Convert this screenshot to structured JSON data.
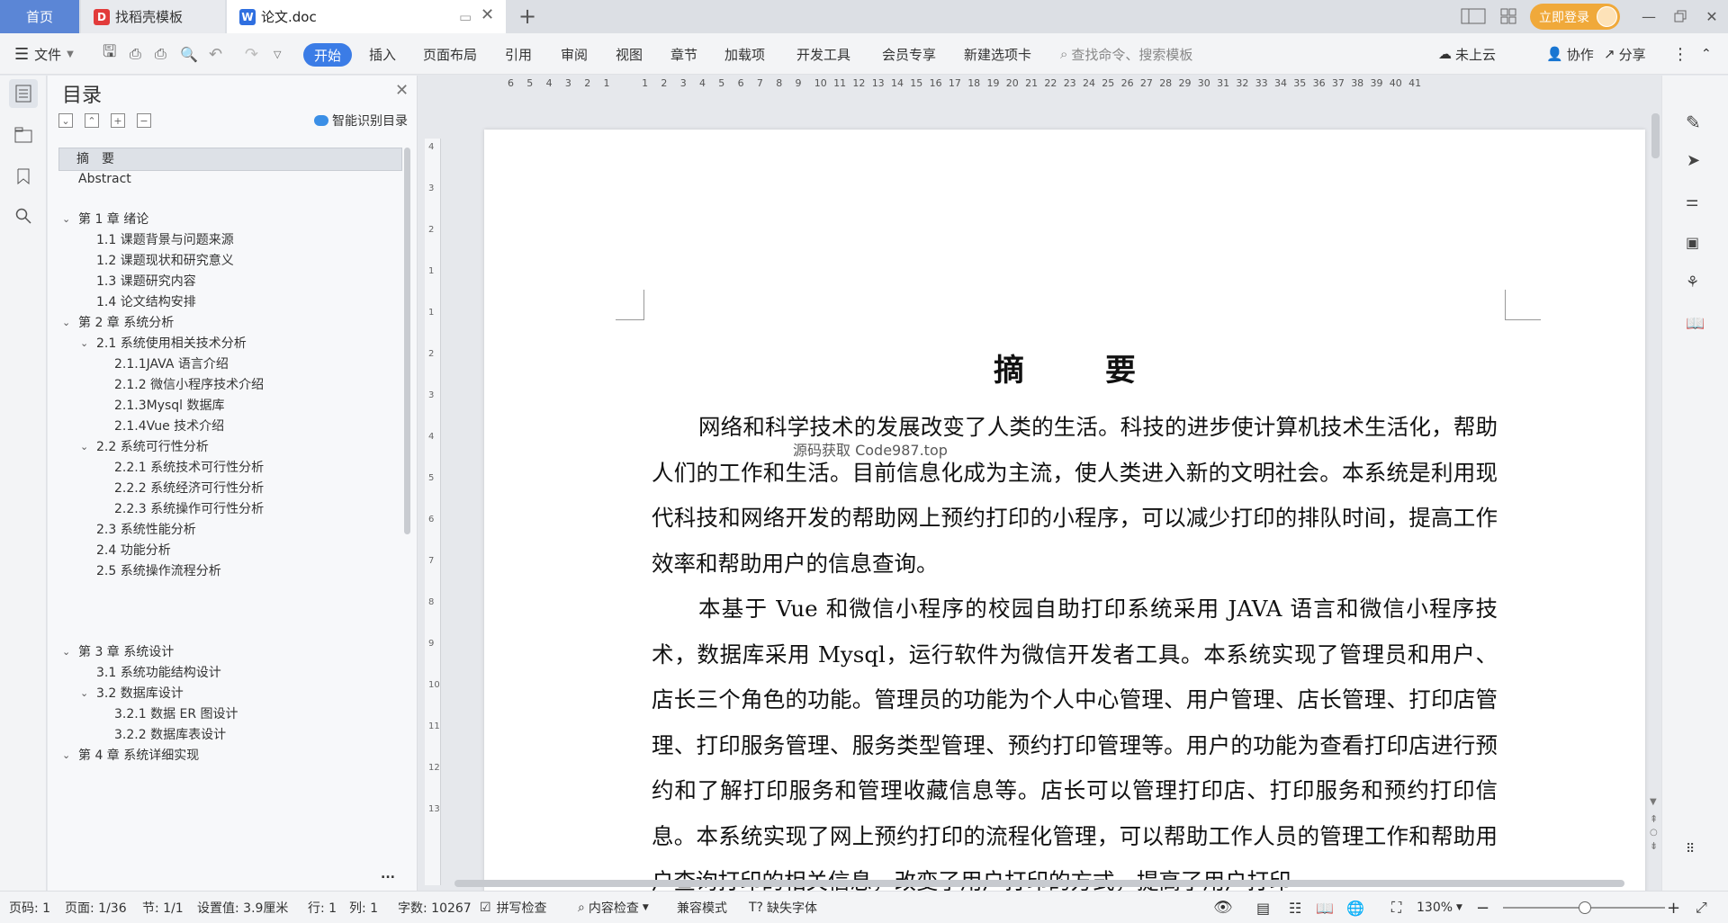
{
  "tabs": {
    "home": "首页",
    "docer": "找稻壳模板",
    "doc": "论文.doc",
    "login": "立即登录"
  },
  "ribbon": {
    "file": "文件",
    "items": [
      "开始",
      "插入",
      "页面布局",
      "引用",
      "审阅",
      "视图",
      "章节",
      "加载项",
      "开发工具",
      "会员专享",
      "新建选项卡"
    ],
    "search_placeholder": "查找命令、搜索模板",
    "cloud": "未上云",
    "collab": "协作",
    "share": "分享"
  },
  "toc": {
    "title": "目录",
    "smart": "智能识别目录",
    "items": [
      {
        "label": "摘　要",
        "level": 0
      },
      {
        "label": "Abstract",
        "level": 0
      },
      {
        "label": "第 1 章  绪论",
        "level": 0
      },
      {
        "label": "1.1 课题背景与问题来源",
        "level": 1
      },
      {
        "label": "1.2 课题现状和研究意义",
        "level": 1
      },
      {
        "label": "1.3 课题研究内容",
        "level": 1
      },
      {
        "label": "1.4 论文结构安排",
        "level": 1
      },
      {
        "label": "第 2 章  系统分析",
        "level": 0
      },
      {
        "label": "2.1 系统使用相关技术分析",
        "level": 1
      },
      {
        "label": "2.1.1JAVA 语言介绍",
        "level": 2
      },
      {
        "label": "2.1.2 微信小程序技术介绍",
        "level": 2
      },
      {
        "label": "2.1.3Mysql 数据库",
        "level": 2
      },
      {
        "label": "2.1.4Vue 技术介绍",
        "level": 2
      },
      {
        "label": "2.2 系统可行性分析",
        "level": 1
      },
      {
        "label": "2.2.1 系统技术可行性分析",
        "level": 2
      },
      {
        "label": "2.2.2 系统经济可行性分析",
        "level": 2
      },
      {
        "label": "2.2.3 系统操作可行性分析",
        "level": 2
      },
      {
        "label": "2.3 系统性能分析",
        "level": 1
      },
      {
        "label": "2.4 功能分析",
        "level": 1
      },
      {
        "label": "2.5 系统操作流程分析",
        "level": 1
      },
      {
        "label": "第 3 章  系统设计",
        "level": 0
      },
      {
        "label": "3.1 系统功能结构设计",
        "level": 1
      },
      {
        "label": "3.2 数据库设计",
        "level": 1
      },
      {
        "label": "3.2.1 数据 ER 图设计",
        "level": 2
      },
      {
        "label": "3.2.2 数据库表设计",
        "level": 2
      },
      {
        "label": "第 4 章  系统详细实现",
        "level": 0
      }
    ],
    "more": "..."
  },
  "ruler": {
    "labels": [
      "6",
      "5",
      "4",
      "3",
      "2",
      "1",
      "",
      "1",
      "2",
      "3",
      "4",
      "5",
      "6",
      "7",
      "8",
      "9",
      "10",
      "11",
      "12",
      "13",
      "14",
      "15",
      "16",
      "17",
      "18",
      "19",
      "20",
      "21",
      "22",
      "23",
      "24",
      "25",
      "26",
      "27",
      "28",
      "29",
      "30",
      "31",
      "32",
      "33",
      "34",
      "35",
      "36",
      "37",
      "38",
      "39",
      "40",
      "41"
    ]
  },
  "vruler": {
    "labels": [
      "4",
      "3",
      "2",
      "1",
      "1",
      "2",
      "3",
      "4",
      "5",
      "6",
      "7",
      "8",
      "9",
      "10",
      "11",
      "12",
      "13"
    ]
  },
  "document": {
    "title": "摘　要",
    "watermark": "源码获取 Code987.top",
    "paragraphs": [
      "网络和科学技术的发展改变了人类的生活。科技的进步使计算机技术生活化，帮助人们的工作和生活。目前信息化成为主流，使人类进入新的文明社会。本系统是利用现代科技和网络开发的帮助网上预约打印的小程序，可以减少打印的排队时间，提高工作效率和帮助用户的信息查询。",
      "本基于 Vue 和微信小程序的校园自助打印系统采用 JAVA 语言和微信小程序技术，数据库采用 Mysql，运行软件为微信开发者工具。本系统实现了管理员和用户、店长三个角色的功能。管理员的功能为个人中心管理、用户管理、店长管理、打印店管理、打印服务管理、服务类型管理、预约打印管理等。用户的功能为查看打印店进行预约和了解打印服务和管理收藏信息等。店长可以管理打印店、打印服务和预约打印信息。本系统实现了网上预约打印的流程化管理，可以帮助工作人员的管理工作和帮助用户查询打印的相关信息，改变了用户打印的方式，提高了用户打印"
    ]
  },
  "status": {
    "page": "页码: 1",
    "pages": "页面: 1/36",
    "section": "节: 1/1",
    "setting": "设置值: 3.9厘米",
    "row": "行: 1",
    "col": "列: 1",
    "words": "字数: 10267",
    "spell": "拼写检查",
    "content": "内容检查",
    "compat": "兼容模式",
    "font": "缺失字体",
    "zoom": "130%"
  },
  "colors": {
    "accent": "#3b7ce6",
    "home_tab": "#5b86d6",
    "login": "#f0a93a"
  }
}
